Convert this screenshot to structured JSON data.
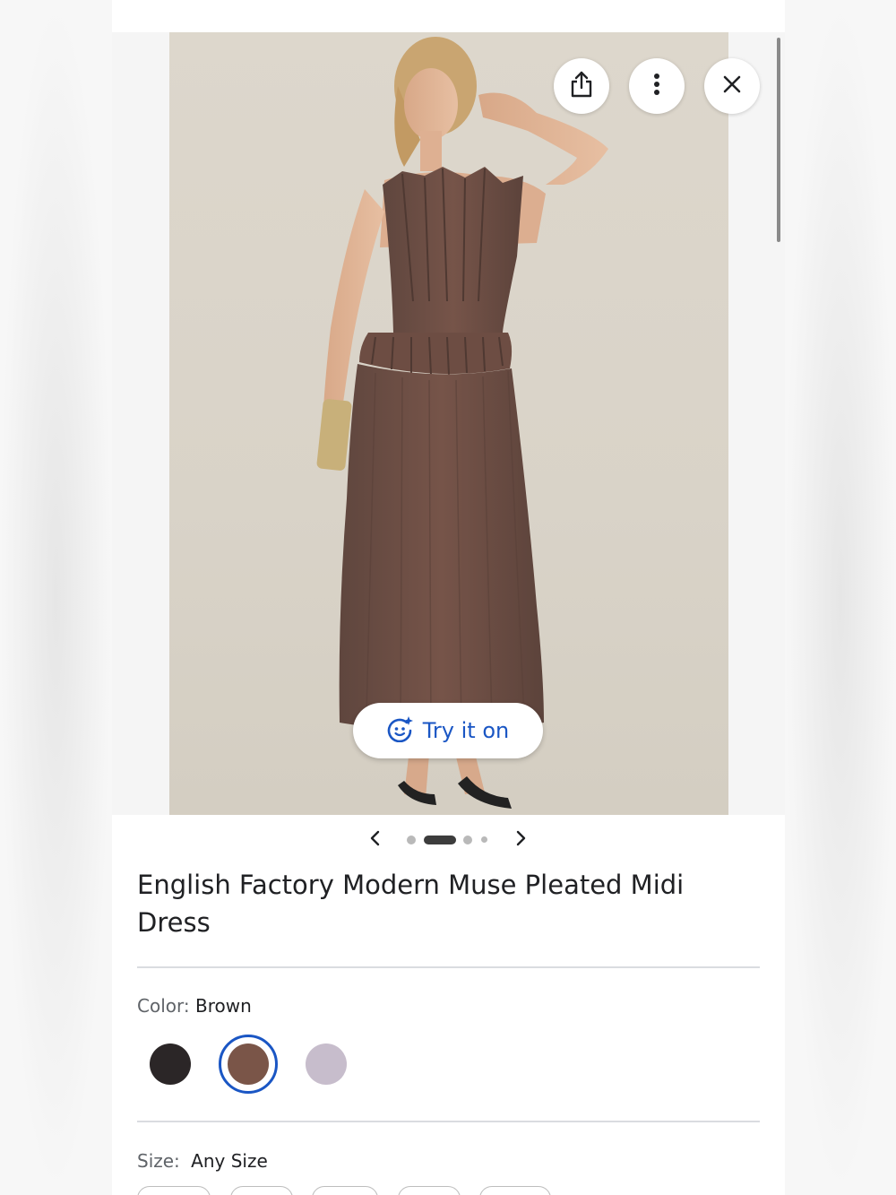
{
  "product": {
    "title": "English Factory Modern Muse Pleated Midi Dress",
    "color_label": "Color:",
    "color_value": "Brown",
    "size_label": "Size:",
    "size_value": "Any Size"
  },
  "actions": {
    "try_on_label": "Try it on"
  },
  "gallery": {
    "image_count": 5,
    "current_index": 2
  },
  "colors": {
    "accent": "#1a56c4",
    "swatches": [
      {
        "name": "Black",
        "hex": "#2b2627",
        "selected": false
      },
      {
        "name": "Brown",
        "hex": "#7a5548",
        "selected": true
      },
      {
        "name": "Lilac",
        "hex": "#c7bdcc",
        "selected": false
      }
    ]
  },
  "icons": [
    "share-icon",
    "more-vert-icon",
    "close-icon",
    "try-on-sparkle-icon",
    "chevron-left-icon",
    "chevron-right-icon"
  ]
}
